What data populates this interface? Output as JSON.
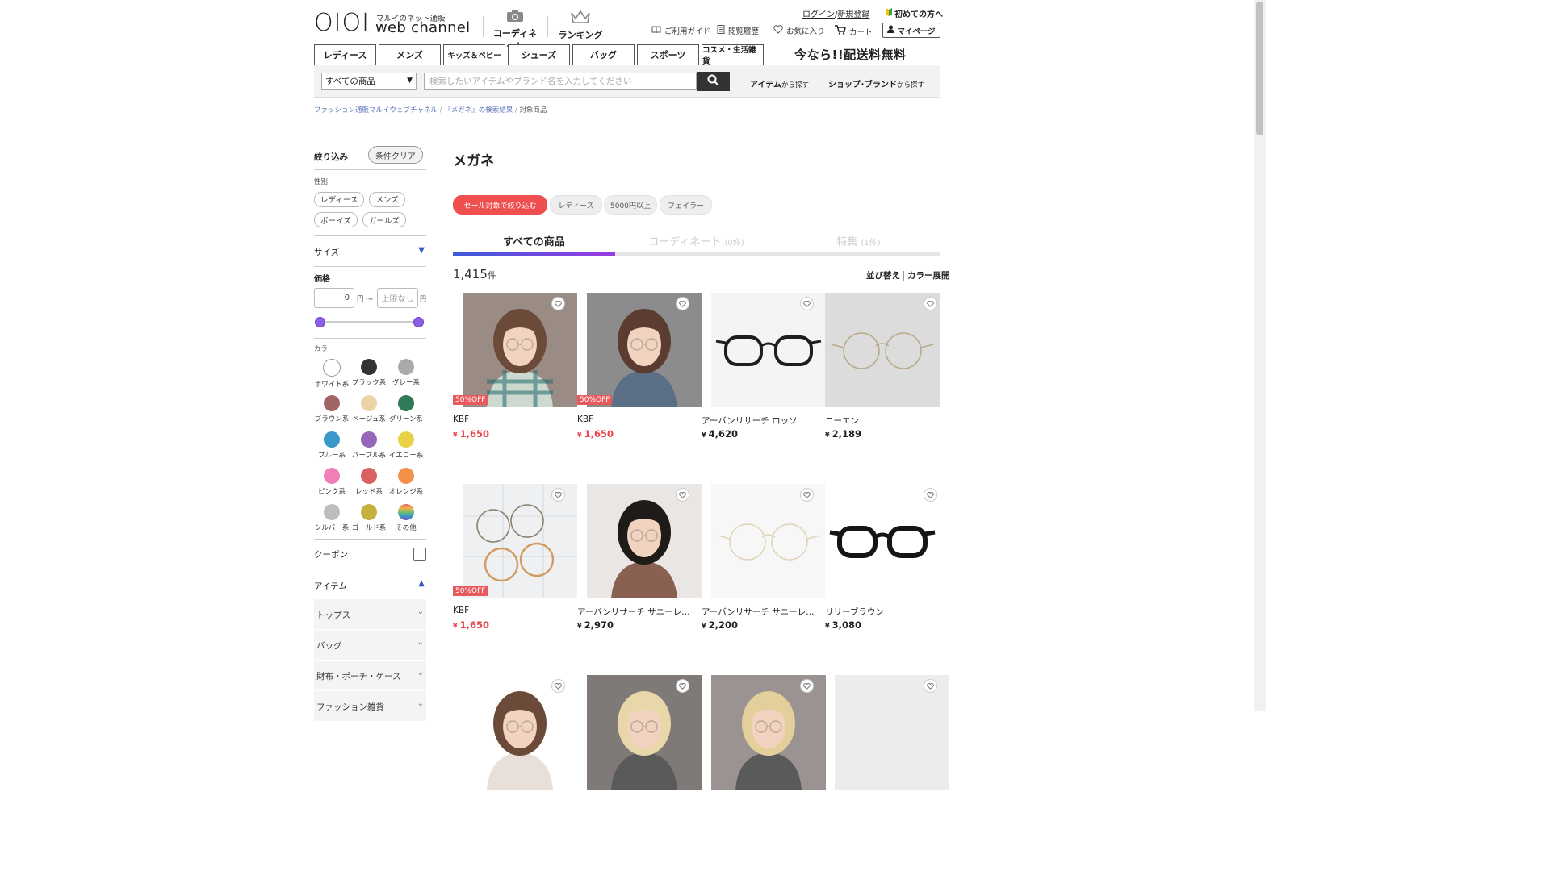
{
  "header": {
    "logo_text": "OIOI",
    "logo_sub": "マルイのネット通販",
    "logo_main": "web channel",
    "coordinate_label": "コーディネート",
    "ranking_label": "ランキング",
    "login": "ログイン",
    "slash": "/",
    "register": "新規登録",
    "first_time": "初めての方へ",
    "guide": "ご利用ガイド",
    "history": "閲覧履歴",
    "favorites": "お気に入り",
    "cart": "カート",
    "mypage": "マイページ"
  },
  "categories": [
    "レディース",
    "メンズ",
    "キッズ＆ベビー",
    "シューズ",
    "バッグ",
    "スポーツ",
    "コスメ・生活雑貨"
  ],
  "promo": "今なら!!配送料無料",
  "search": {
    "select_value": "すべての商品",
    "placeholder": "検索したいアイテムやブランド名を入力してください",
    "find_item": "アイテム",
    "find_shop": "ショップ･ブランド",
    "from_search": "から探す"
  },
  "breadcrumb": [
    "ファッション通販マルイウェブチャネル",
    "『メガネ』の検索結果",
    "対象商品"
  ],
  "breadcrumb_sep": "/",
  "sidebar": {
    "filter_title": "絞り込み",
    "clear_button": "条件クリア",
    "gender_label": "性別",
    "genders": [
      "レディース",
      "メンズ",
      "ボーイズ",
      "ガールズ"
    ],
    "size_label": "サイズ",
    "price_label": "価格",
    "price_min": "0",
    "price_max_placeholder": "上限なし",
    "yen": "円",
    "tilde": "〜",
    "color_label": "カラー",
    "colors": [
      {
        "name": "ホワイト系",
        "hex": "#ffffff"
      },
      {
        "name": "ブラック系",
        "hex": "#333333"
      },
      {
        "name": "グレー系",
        "hex": "#aaaaaa"
      },
      {
        "name": "ブラウン系",
        "hex": "#a06565"
      },
      {
        "name": "ベージュ系",
        "hex": "#ead3a5"
      },
      {
        "name": "グリーン系",
        "hex": "#2f7a57"
      },
      {
        "name": "ブルー系",
        "hex": "#3a98c8"
      },
      {
        "name": "パープル系",
        "hex": "#9467b8"
      },
      {
        "name": "イエロー系",
        "hex": "#ead246"
      },
      {
        "name": "ピンク系",
        "hex": "#f07fb5"
      },
      {
        "name": "レッド系",
        "hex": "#d96162"
      },
      {
        "name": "オレンジ系",
        "hex": "#f5904a"
      },
      {
        "name": "シルバー系",
        "hex": "#bdbdbd"
      },
      {
        "name": "ゴールド系",
        "hex": "#c7b13e"
      },
      {
        "name": "その他",
        "hex": "multicolor"
      }
    ],
    "coupon_label": "クーポン",
    "item_label": "アイテム",
    "item_categories": [
      "トップス",
      "バッグ",
      "財布・ポーチ・ケース",
      "ファッション雑貨"
    ]
  },
  "main": {
    "title": "メガネ",
    "chips": [
      "セール対象で絞り込む",
      "レディース",
      "5000円以上",
      "フェイラー"
    ],
    "tabs": [
      {
        "label": "すべての商品",
        "count": ""
      },
      {
        "label": "コーディネート",
        "count": "(0件)"
      },
      {
        "label": "特集",
        "count": "(1件)"
      }
    ],
    "result_count": "1,415",
    "result_unit": "件",
    "sort_label": "並び替え",
    "color_expand_label": "カラー展開",
    "currency": "¥",
    "products": [
      {
        "brand": "KBF",
        "price": "1,650",
        "discount": "50%OFF",
        "sale": true
      },
      {
        "brand": "KBF",
        "price": "1,650",
        "discount": "50%OFF",
        "sale": true
      },
      {
        "brand": "アーバンリサーチ ロッソ",
        "price": "4,620",
        "discount": "",
        "sale": false
      },
      {
        "brand": "コーエン",
        "price": "2,189",
        "discount": "",
        "sale": false
      },
      {
        "brand": "KBF",
        "price": "1,650",
        "discount": "50%OFF",
        "sale": true
      },
      {
        "brand": "アーバンリサーチ サニーレーベル",
        "price": "2,970",
        "discount": "",
        "sale": false
      },
      {
        "brand": "アーバンリサーチ サニーレーベル",
        "price": "2,200",
        "discount": "",
        "sale": false
      },
      {
        "brand": "リリーブラウン",
        "price": "3,080",
        "discount": "",
        "sale": false
      }
    ]
  },
  "colors": {
    "accent_red": "#ef4f4f",
    "sale_red": "#e8464b",
    "tab_gradient_start": "#3b5bdb",
    "tab_gradient_end": "#9b3be0",
    "link_blue": "#5b74b8"
  }
}
